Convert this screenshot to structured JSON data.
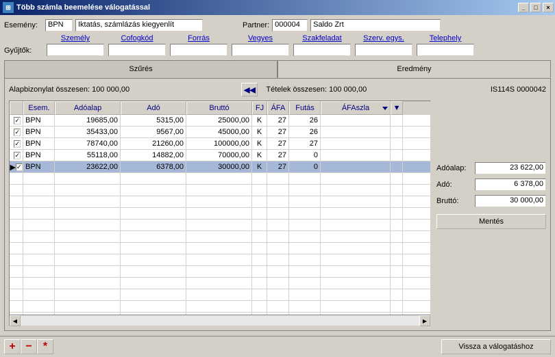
{
  "title": "Több számla beemelése válogatással",
  "window_controls": {
    "min": "_",
    "max": "□",
    "close": "×"
  },
  "header": {
    "esemeny_label": "Esemény:",
    "esemeny_code": "BPN",
    "esemeny_text": "Iktatás, számlázás kiegyenlít",
    "partner_label": "Partner:",
    "partner_code": "000004",
    "partner_name": "Saldo Zrt"
  },
  "gyujtok": {
    "label": "Gyűjtők:",
    "cols": [
      "Személy",
      "Cofogkód",
      "Forrás",
      "Vegyes",
      "Szakfeladat",
      "Szerv. egys.",
      "Telephely"
    ]
  },
  "tabs": {
    "left": "Szűrés",
    "right": "Eredmény"
  },
  "summary": {
    "alap_label": "Alapbizonylat összesen: 100 000,00",
    "tetel_label": "Tételek összesen: 100 000,00",
    "doc_id": "IS114S 0000042"
  },
  "table": {
    "headers": [
      "",
      "Esem.",
      "Adóalap",
      "Adó",
      "Bruttó",
      "FJ",
      "ÁFA",
      "Futás",
      "ÁFAszla",
      "▼"
    ],
    "rows": [
      {
        "chk": true,
        "esem": "BPN",
        "adoalap": "19685,00",
        "ado": "5315,00",
        "brutto": "25000,00",
        "fj": "K",
        "afa": "27",
        "futas": "26",
        "afaszla": ""
      },
      {
        "chk": true,
        "esem": "BPN",
        "adoalap": "35433,00",
        "ado": "9567,00",
        "brutto": "45000,00",
        "fj": "K",
        "afa": "27",
        "futas": "26",
        "afaszla": ""
      },
      {
        "chk": true,
        "esem": "BPN",
        "adoalap": "78740,00",
        "ado": "21260,00",
        "brutto": "100000,00",
        "fj": "K",
        "afa": "27",
        "futas": "27",
        "afaszla": ""
      },
      {
        "chk": true,
        "esem": "BPN",
        "adoalap": "55118,00",
        "ado": "14882,00",
        "brutto": "70000,00",
        "fj": "K",
        "afa": "27",
        "futas": "0",
        "afaszla": ""
      },
      {
        "chk": true,
        "esem": "BPN",
        "adoalap": "23622,00",
        "ado": "6378,00",
        "brutto": "30000,00",
        "fj": "K",
        "afa": "27",
        "futas": "0",
        "afaszla": "",
        "selected": true
      }
    ]
  },
  "sidebar": {
    "adoalap_label": "Adóalap:",
    "adoalap_value": "23 622,00",
    "ado_label": "Adó:",
    "ado_value": "6 378,00",
    "brutto_label": "Bruttó:",
    "brutto_value": "30 000,00",
    "save_label": "Mentés"
  },
  "footer": {
    "add": "+",
    "remove": "−",
    "star": "*",
    "back_label": "Vissza a válogatáshoz"
  }
}
